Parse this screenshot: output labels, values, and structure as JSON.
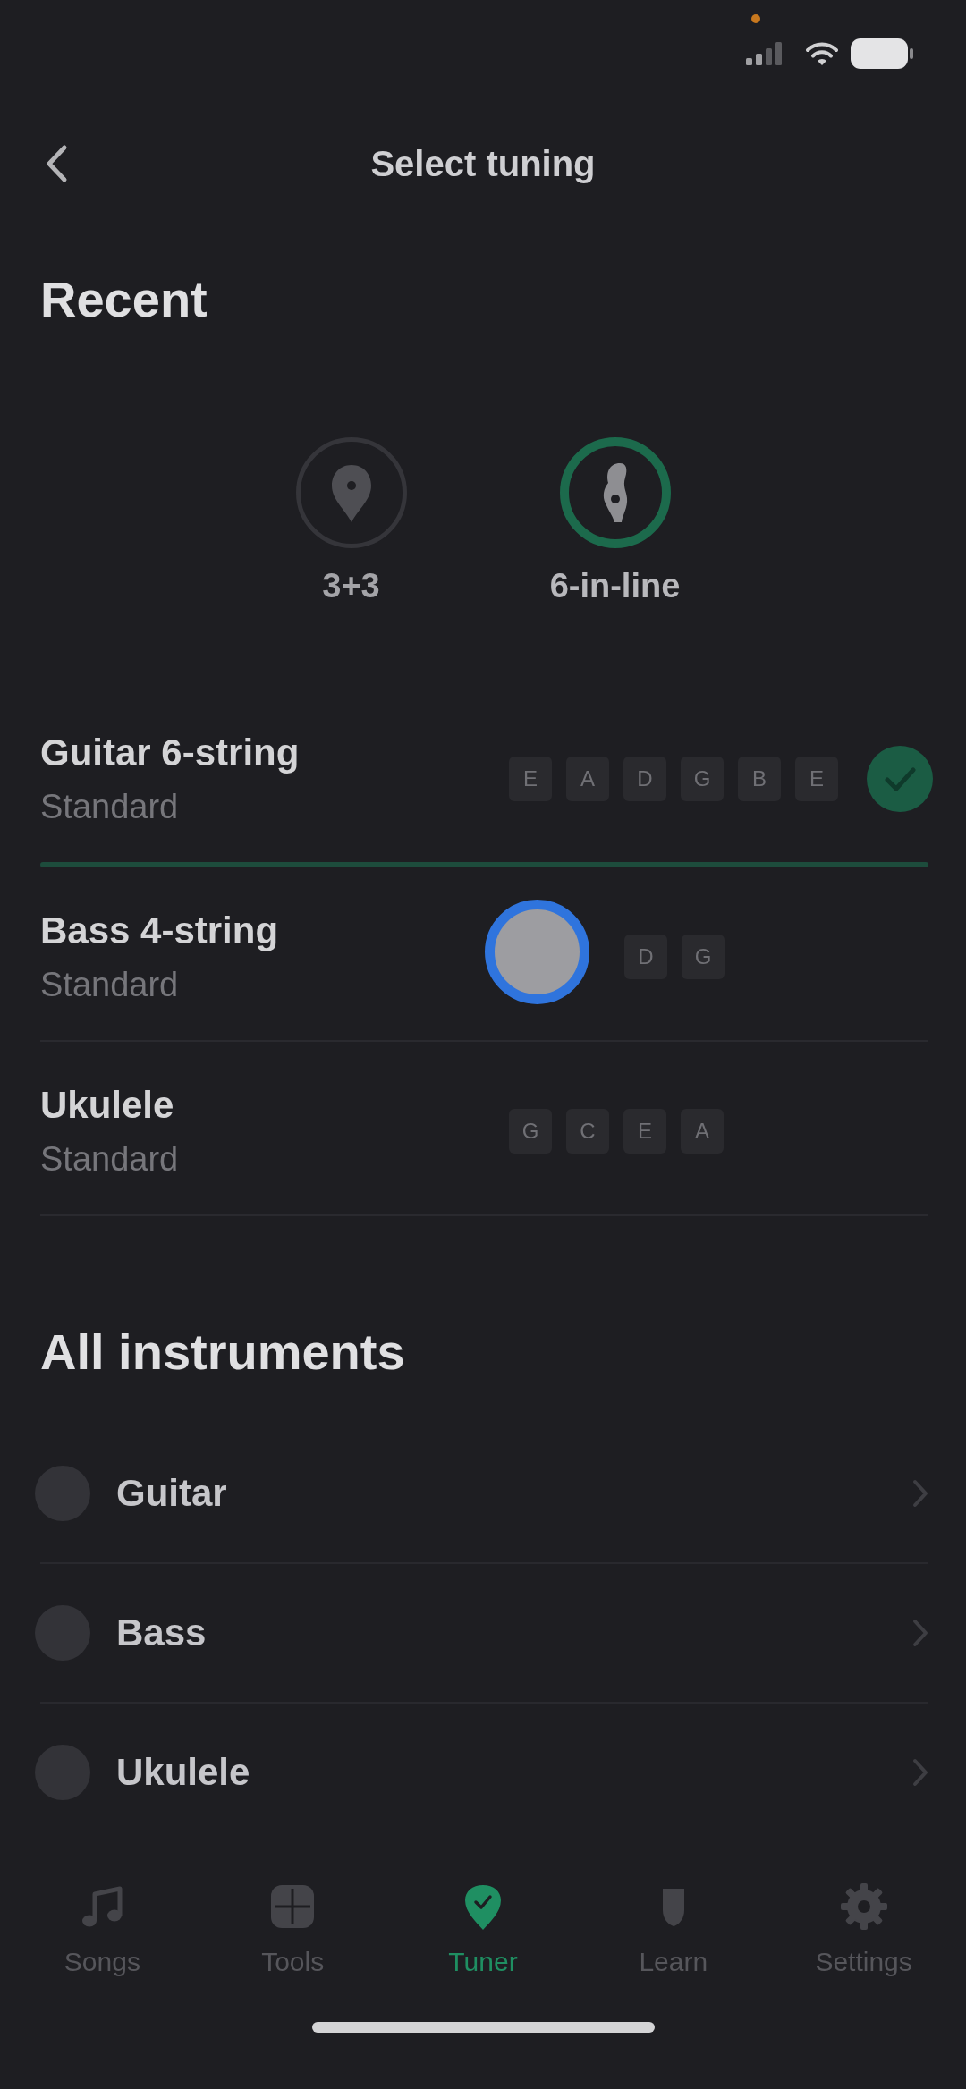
{
  "header": {
    "title": "Select tuning"
  },
  "recent": {
    "heading": "Recent",
    "items": [
      {
        "label": "3+3",
        "selected": false
      },
      {
        "label": "6-in-line",
        "selected": true
      }
    ]
  },
  "tunings": [
    {
      "instrument": "Guitar 6-string",
      "tuning": "Standard",
      "notes": [
        "E",
        "A",
        "D",
        "G",
        "B",
        "E"
      ],
      "selected": true,
      "touch_indicator": false
    },
    {
      "instrument": "Bass 4-string",
      "tuning": "Standard",
      "notes": [
        "D",
        "G"
      ],
      "selected": false,
      "touch_indicator": true
    },
    {
      "instrument": "Ukulele",
      "tuning": "Standard",
      "notes": [
        "G",
        "C",
        "E",
        "A"
      ],
      "selected": false,
      "touch_indicator": false
    }
  ],
  "all_instruments": {
    "heading": "All instruments",
    "items": [
      {
        "label": "Guitar"
      },
      {
        "label": "Bass"
      },
      {
        "label": "Ukulele"
      }
    ]
  },
  "tab_bar": [
    {
      "label": "Songs",
      "selected": false
    },
    {
      "label": "Tools",
      "selected": false
    },
    {
      "label": "Tuner",
      "selected": true
    },
    {
      "label": "Learn",
      "selected": false
    },
    {
      "label": "Settings",
      "selected": false
    }
  ]
}
